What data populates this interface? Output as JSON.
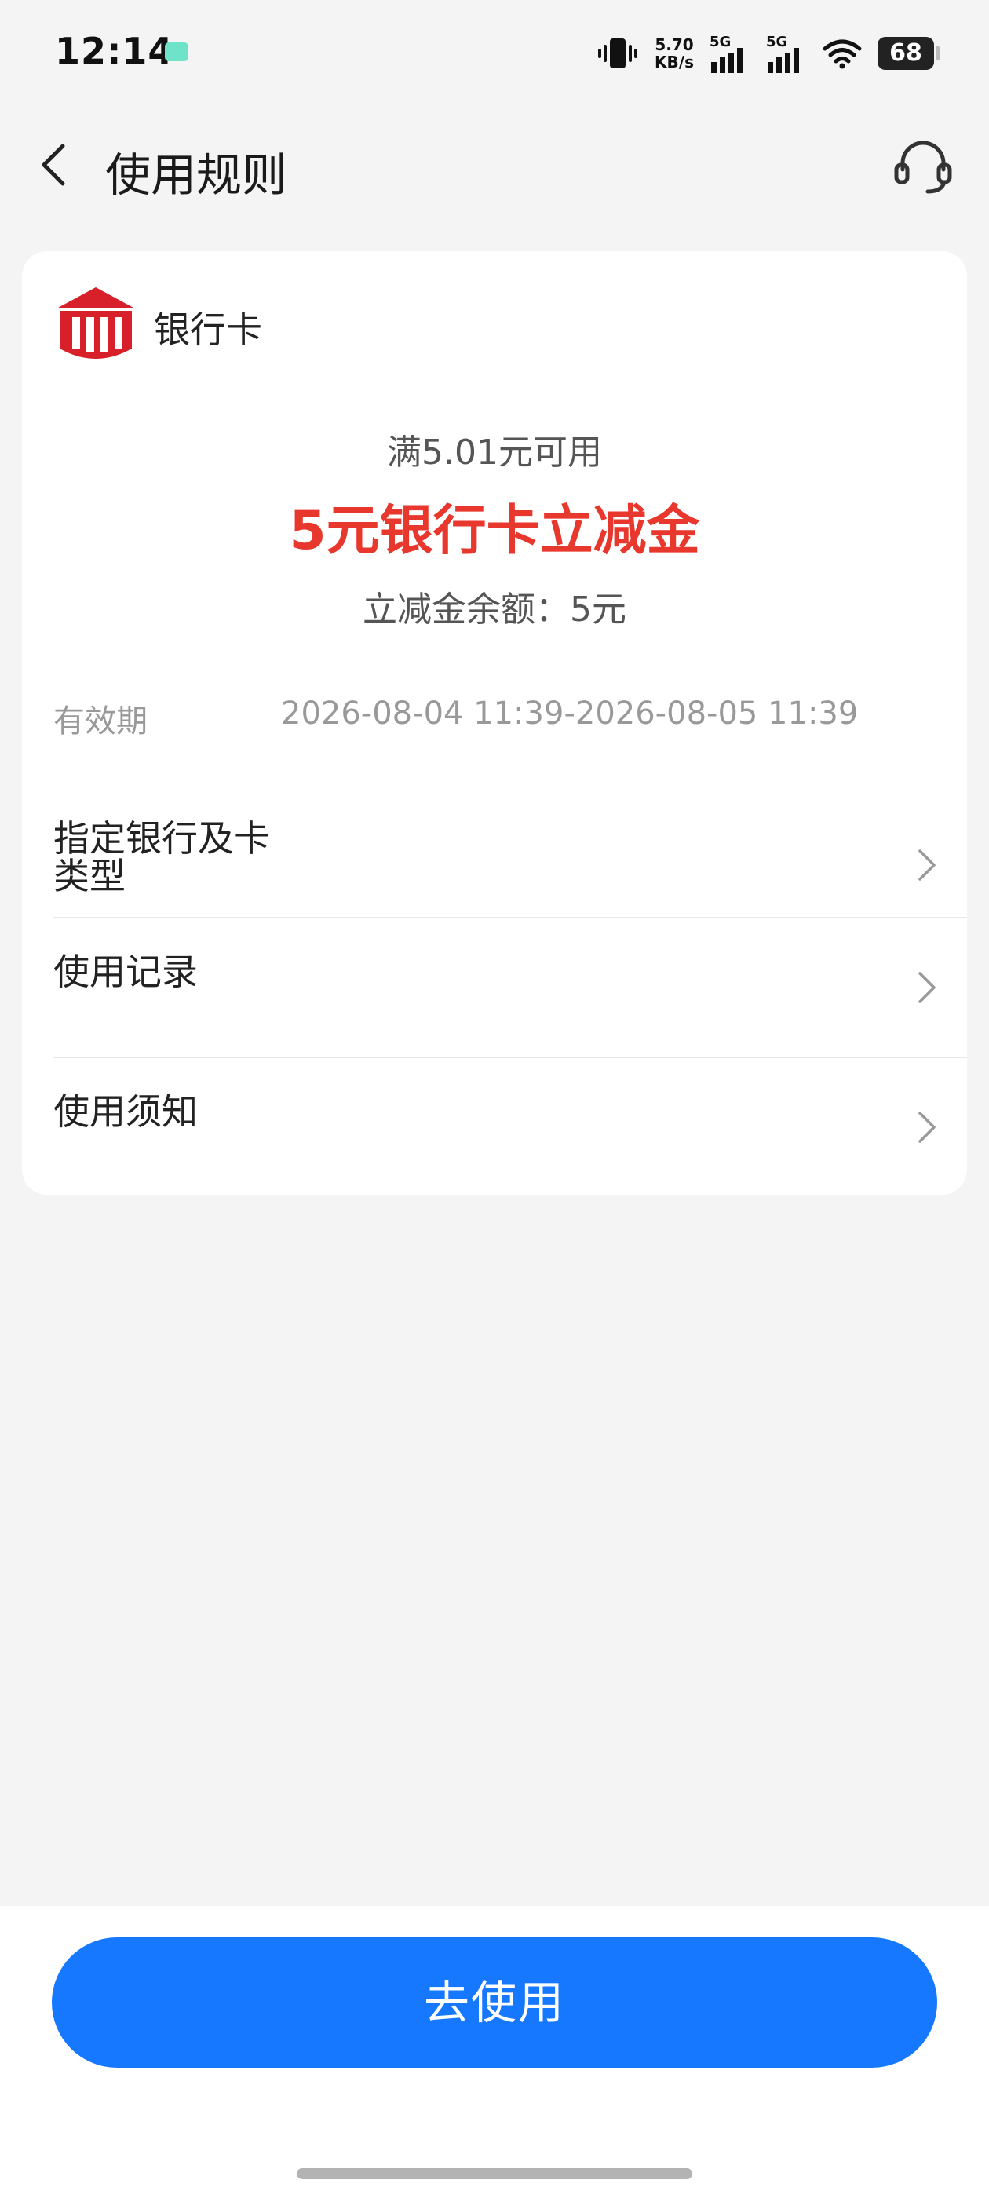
{
  "status_bar": {
    "time": "12:14",
    "net_speed_value": "5.70",
    "net_speed_unit": "KB/s",
    "sim1_tag": "5G",
    "sim2_tag": "5G",
    "battery": "68"
  },
  "header": {
    "title": "使用规则"
  },
  "card": {
    "bank_name": "银行卡",
    "threshold": "满5.01元可用",
    "voucher_title": "5元银行卡立减金",
    "balance": "立减金余额：5元",
    "validity_label": "有效期",
    "validity_value": "2026-08-04 11:39-2026-08-05 11:39",
    "rows": [
      {
        "label_line1": "指定银行及卡",
        "label_line2": "类型"
      },
      {
        "label": "使用记录"
      },
      {
        "label": "使用须知"
      }
    ]
  },
  "footer": {
    "use_button": "去使用"
  },
  "colors": {
    "accent_blue": "#1677ff",
    "voucher_red": "#e8372d",
    "logo_red": "#d7202a"
  },
  "icons": [
    "vibrate-icon",
    "signal-icon",
    "wifi-icon",
    "battery-icon",
    "back-icon",
    "headset-icon",
    "bank-logo-icon",
    "chevron-right-icon"
  ]
}
